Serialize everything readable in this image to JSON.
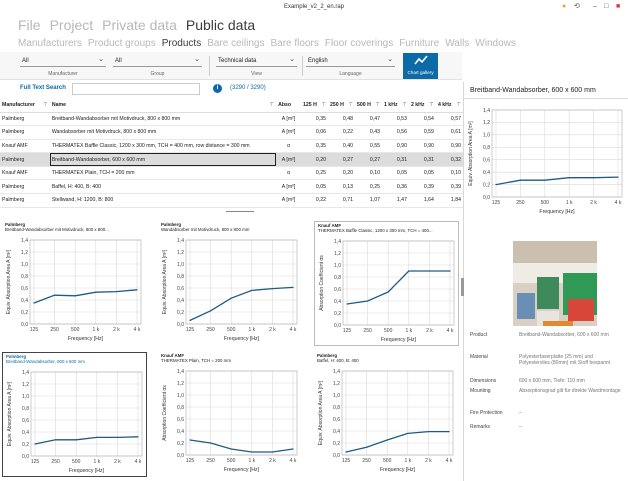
{
  "window": {
    "title": "Example_v2_2_en.rap"
  },
  "menu_primary": {
    "items": [
      "File",
      "Project",
      "Private data",
      "Public data"
    ],
    "active": 3
  },
  "menu_secondary": {
    "items": [
      "Manufacturers",
      "Product groups",
      "Products",
      "Bare ceilings",
      "Bare floors",
      "Floor coverings",
      "Furniture",
      "Walls",
      "Windows"
    ],
    "active": 2
  },
  "filters": {
    "manufacturer": {
      "value": "All",
      "label": "Manufacturer"
    },
    "group": {
      "value": "All",
      "label": "Group"
    },
    "view": {
      "value": "Technical data",
      "label": "View"
    },
    "language": {
      "value": "English",
      "label": "Language"
    },
    "chart_gallery_label": "Chart gallery"
  },
  "search": {
    "link": "Full Text Search",
    "value": "",
    "count": "(3290 / 3290)"
  },
  "table": {
    "columns": [
      "Manufacturer",
      "Name",
      "Abso",
      "125 H",
      "250 H",
      "500 H",
      "1 kHz",
      "2 kHz",
      "4 kHz"
    ],
    "rows": [
      [
        "Palmberg",
        "Breitband-Wandabsorber mit Motivdruck, 800 x 800 mm",
        "A [m²]",
        "0,35",
        "0,48",
        "0,47",
        "0,53",
        "0,54",
        "0,57"
      ],
      [
        "Palmberg",
        "Wandabsorber mit Motivdruck, 800 x 800 mm",
        "A [m²]",
        "0,06",
        "0,22",
        "0,43",
        "0,56",
        "0,59",
        "0,61"
      ],
      [
        "Knauf AMF",
        "THERMATEX Baffle Classic, 1200 x 300 mm, TCH = 400 mm, row distance = 300 mm",
        "α",
        "0,35",
        "0,40",
        "0,55",
        "0,90",
        "0,90",
        "0,90"
      ],
      [
        "Palmberg",
        "Breitband-Wandabsorber, 600 x 600 mm",
        "A [m²]",
        "0,20",
        "0,27",
        "0,27",
        "0,31",
        "0,31",
        "0,32"
      ],
      [
        "Knauf AMF",
        "THERMATEX Plain, TCH = 200 mm",
        "α",
        "0,25",
        "0,20",
        "0,10",
        "0,05",
        "0,05",
        "0,10"
      ],
      [
        "Palmberg",
        "Baffel, H: 400, B: 400",
        "A [m²]",
        "0,05",
        "0,13",
        "0,25",
        "0,36",
        "0,39",
        "0,39"
      ],
      [
        "Palmberg",
        "Stellwand, H: 1200, B: 800",
        "A [m²]",
        "0,22",
        "0,71",
        "1,07",
        "1,47",
        "1,64",
        "1,84"
      ]
    ],
    "selected_row": 3
  },
  "chart_data": [
    {
      "type": "line",
      "manufacturer": "Palmberg",
      "title": "Breitband-Wandabsorber mit Motivdruck, 800 x 800...",
      "ylabel": "Equiv. Absorption Area A [m²]",
      "xlabel": "Frequency [Hz]",
      "categories": [
        "125",
        "250",
        "500",
        "1 k",
        "2 k",
        "4 k"
      ],
      "values": [
        0.35,
        0.48,
        0.47,
        0.53,
        0.54,
        0.57
      ],
      "ylim": [
        0,
        1.4
      ],
      "yticks": [
        "0,0",
        "0,2",
        "0,4",
        "0,6",
        "0,8",
        "1,0",
        "1,2",
        "1,4"
      ],
      "grid": true
    },
    {
      "type": "line",
      "manufacturer": "Palmberg",
      "title": "Wandabsorber mit Motivdruck, 800 x 800 mm",
      "ylabel": "Equiv. Absorption Area A [m²]",
      "xlabel": "Frequency [Hz]",
      "categories": [
        "125",
        "250",
        "500",
        "1 k",
        "2 k",
        "4 k"
      ],
      "values": [
        0.06,
        0.22,
        0.43,
        0.56,
        0.59,
        0.61
      ],
      "ylim": [
        0,
        1.4
      ],
      "yticks": [
        "0,0",
        "0,2",
        "0,4",
        "0,6",
        "0,8",
        "1,0",
        "1,2",
        "1,4"
      ],
      "grid": true
    },
    {
      "type": "line",
      "manufacturer": "Knauf AMF",
      "title": "THERMATEX Baffle Classic, 1200 x 300 mm, TCH = 400...",
      "ylabel": "Absorption Coefficient αs",
      "xlabel": "Frequency [Hz]",
      "categories": [
        "125",
        "250",
        "500",
        "1 k",
        "2 k",
        "4 k"
      ],
      "values": [
        0.35,
        0.4,
        0.55,
        0.9,
        0.9,
        0.9
      ],
      "ylim": [
        0,
        1.4
      ],
      "yticks": [
        "0,0",
        "0,2",
        "0,4",
        "0,6",
        "0,8",
        "1,0",
        "1,2",
        "1,4"
      ],
      "grid": true
    },
    {
      "type": "line",
      "manufacturer": "Palmberg",
      "title": "Breitband-Wandabsorber, 600 x 600 mm",
      "ylabel": "Equiv. Absorption Area A [m²]",
      "xlabel": "Frequency [Hz]",
      "categories": [
        "125",
        "250",
        "500",
        "1 k",
        "2 k",
        "4 k"
      ],
      "values": [
        0.2,
        0.27,
        0.27,
        0.31,
        0.31,
        0.32
      ],
      "ylim": [
        0,
        1.4
      ],
      "yticks": [
        "0,0",
        "0,2",
        "0,4",
        "0,6",
        "0,8",
        "1,0",
        "1,2",
        "1,4"
      ],
      "grid": true
    },
    {
      "type": "line",
      "manufacturer": "Knauf AMF",
      "title": "THERMATEX Plain, TCH = 200 mm",
      "ylabel": "Absorption Coefficient αs",
      "xlabel": "Frequency [Hz]",
      "categories": [
        "125",
        "250",
        "500",
        "1 k",
        "2 k",
        "4 k"
      ],
      "values": [
        0.25,
        0.2,
        0.1,
        0.05,
        0.05,
        0.1
      ],
      "ylim": [
        0,
        1.4
      ],
      "yticks": [
        "0,0",
        "0,2",
        "0,4",
        "0,6",
        "0,8",
        "1,0",
        "1,2",
        "1,4"
      ],
      "grid": true
    },
    {
      "type": "line",
      "manufacturer": "Palmberg",
      "title": "Baffel, H: 400, B: 400",
      "ylabel": "Equiv. Absorption Area A [m²]",
      "xlabel": "Frequency [Hz]",
      "categories": [
        "125",
        "250",
        "500",
        "1 k",
        "2 k",
        "4 k"
      ],
      "values": [
        0.05,
        0.13,
        0.25,
        0.36,
        0.39,
        0.39
      ],
      "ylim": [
        0,
        1.4
      ],
      "yticks": [
        "0,0",
        "0,2",
        "0,4",
        "0,6",
        "0,8",
        "1,0",
        "1,2",
        "1,4"
      ],
      "grid": true
    },
    {
      "type": "line",
      "title": "",
      "ylabel": "Equiv. Absorption Area A [m²]",
      "xlabel": "Frequency [Hz]",
      "categories": [
        "125",
        "250",
        "500",
        "1 k",
        "2 k",
        "4 k"
      ],
      "values": [
        0.2,
        0.27,
        0.27,
        0.31,
        0.31,
        0.32
      ],
      "ylim": [
        0,
        1.4
      ],
      "yticks": [
        "0,0",
        "0,2",
        "0,4",
        "0,6",
        "0,8",
        "1,0",
        "1,2",
        "1,4"
      ],
      "grid": true
    }
  ],
  "detail": {
    "title": "Breitband-Wandabsorber, 600 x 600 mm",
    "properties": [
      {
        "key": "Product",
        "value": "Breitband-Wandabsorber, 600 x 600 mm"
      },
      {
        "key": "Material",
        "value": "Polyesterfaserplatte (25 mm) und Polyesterviles (80mm) mit Stoff bespannt"
      },
      {
        "key": "Dimensions",
        "value": "600 x 600 mm, Tiefe: 110 mm"
      },
      {
        "key": "Mounting",
        "value": "Absorptionsgrad gilt für direkte Wandmontage"
      },
      {
        "key": "Fire Protection",
        "value": "–"
      },
      {
        "key": "Remarks",
        "value": "–"
      }
    ]
  },
  "colors": {
    "accent": "#0c6aa6",
    "line": "#1f5a86",
    "grid": "#d9d9d9",
    "selected": "#dcdcdc",
    "status_dot": "#f0a030"
  }
}
